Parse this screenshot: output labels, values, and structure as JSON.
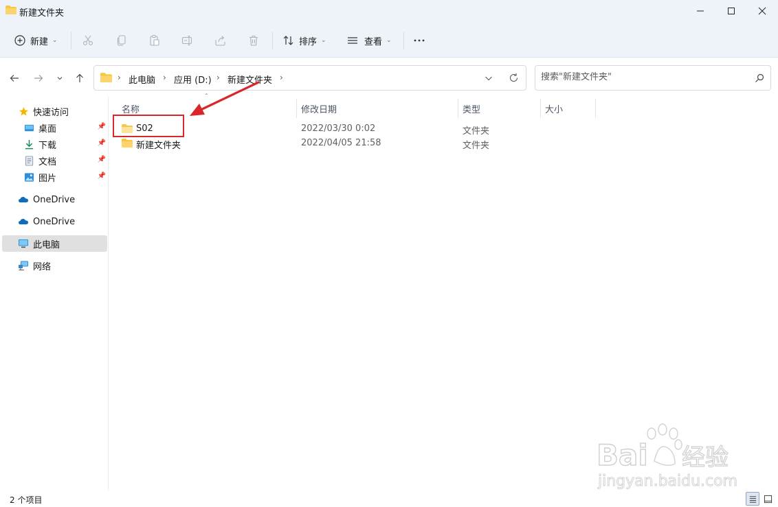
{
  "window": {
    "title": "新建文件夹",
    "controls": [
      "minimize-icon",
      "maximize-icon",
      "close-icon"
    ]
  },
  "toolbar": {
    "new_label": "新建",
    "sort_label": "排序",
    "view_label": "查看",
    "icons": [
      "cut-icon",
      "copy-icon",
      "paste-icon",
      "rename-icon",
      "share-icon",
      "delete-icon",
      "more-icon"
    ]
  },
  "navigation": {
    "breadcrumb": [
      "此电脑",
      "应用 (D:)",
      "新建文件夹"
    ],
    "search_placeholder": "搜索\"新建文件夹\""
  },
  "sidebar": {
    "quick_access": "快速访问",
    "items": [
      {
        "label": "桌面",
        "icon": "desktop-icon",
        "pinned": true
      },
      {
        "label": "下载",
        "icon": "download-icon",
        "pinned": true
      },
      {
        "label": "文档",
        "icon": "document-icon",
        "pinned": true
      },
      {
        "label": "图片",
        "icon": "pictures-icon",
        "pinned": true
      }
    ],
    "onedrive_1": "OneDrive",
    "onedrive_2": "OneDrive",
    "this_pc": "此电脑",
    "network": "网络"
  },
  "columns": {
    "name": "名称",
    "date": "修改日期",
    "type": "类型",
    "size": "大小"
  },
  "files": [
    {
      "name": "S02",
      "date": "2022/03/30 0:02",
      "type": "文件夹",
      "size": ""
    },
    {
      "name": "新建文件夹",
      "date": "2022/04/05 21:58",
      "type": "文件夹",
      "size": ""
    }
  ],
  "status": {
    "item_count": "2 个项目"
  },
  "watermark": {
    "brand": "Baidu经验",
    "url": "jingyan.baidu.com"
  },
  "colors": {
    "accent": "#0067c0",
    "folder": "#f7c548",
    "annotation": "#d8262a",
    "titlebar_bg": "#eef2f9"
  }
}
